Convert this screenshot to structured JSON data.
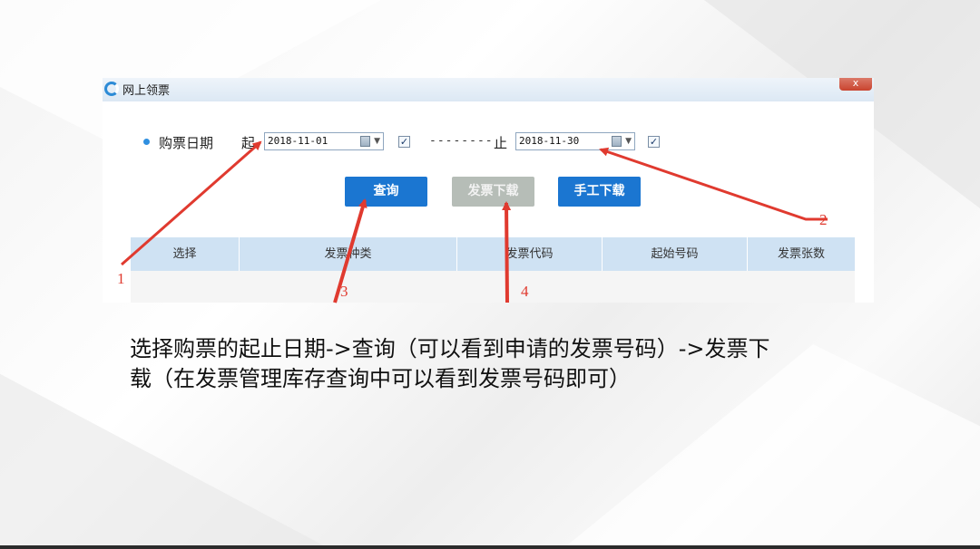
{
  "dialog": {
    "title": "网上领票",
    "close_label": "x",
    "purchase_date_label": "购票日期",
    "start_label": "起",
    "start_date": "2018-11-01",
    "start_checked": "✓",
    "range_separator": "--------",
    "end_label": "止",
    "end_date": "2018-11-30",
    "end_checked": "✓",
    "buttons": {
      "query": "查询",
      "invoice_download": "发票下载",
      "manual_download": "手工下载"
    },
    "table": {
      "columns": [
        "选择",
        "发票种类",
        "发票代码",
        "起始号码",
        "发票张数"
      ]
    }
  },
  "annotations": {
    "markers": [
      "1",
      "2",
      "3",
      "4"
    ],
    "color": "#e03a2f"
  },
  "caption": {
    "line1": "选择购票的起止日期->查询（可以看到申请的发票号码）->发票下",
    "line2": "载（在发票管理库存查询中可以看到发票号码即可）"
  },
  "colors": {
    "accent_blue": "#1b76d1",
    "disabled_grey": "#b6bdb7",
    "table_header": "#cfe2f3"
  }
}
